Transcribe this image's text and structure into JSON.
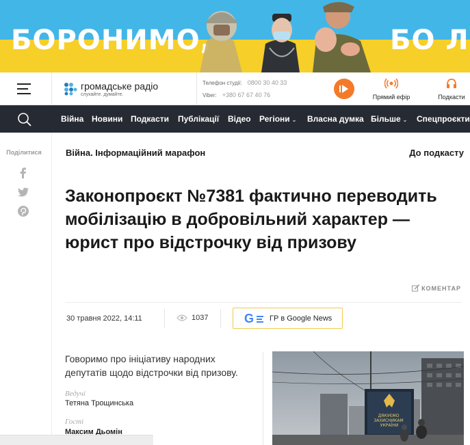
{
  "banner": {
    "text_left": "БОРОНИМО,",
    "text_right": "БО ЛК"
  },
  "header": {
    "logo_name": "громадське радіо",
    "logo_slogan": "слухайте. думайте.",
    "contacts": [
      {
        "label": "Телефон студії:",
        "value": "0800 30 40 33"
      },
      {
        "label": "Viber:",
        "value": "+380 67 67 40 76"
      }
    ],
    "live_label": "Прямий ефір",
    "podcasts_label": "Подкасти"
  },
  "nav": {
    "items": [
      {
        "label": "Війна",
        "dropdown": false
      },
      {
        "label": "Новини",
        "dropdown": false
      },
      {
        "label": "Подкасти",
        "dropdown": false
      },
      {
        "label": "Публікації",
        "dropdown": false
      },
      {
        "label": "Відео",
        "dropdown": false
      },
      {
        "label": "Регіони",
        "dropdown": true
      },
      {
        "label": "Власна думка",
        "dropdown": false
      },
      {
        "label": "Більше",
        "dropdown": true
      },
      {
        "label": "Спецпроєкти",
        "dropdown": false
      }
    ]
  },
  "share": {
    "label": "Поділитися",
    "icons": [
      "facebook-icon",
      "twitter-icon",
      "pinterest-icon"
    ]
  },
  "article": {
    "category": "Війна. Інформаційний марафон",
    "to_podcast": "До подкасту",
    "title": "Законопроєкт №7381 фактично переводить мобілізацію в добровільний характер — юрист про відстрочку від призову",
    "comment_label": "КОМЕНТАР",
    "date": "30 травня 2022, 14:11",
    "views": "1037",
    "google_news_label": "ГР в Google News",
    "lead": "Говоримо про ініціативу народних депутатів щодо відстрочки від призову.",
    "hosts_label": "Ведучі",
    "host": "Тетяна Трощинська",
    "guests_label": "Гості",
    "guest": "Максим Дьомін",
    "photo_billboard_text": "ДЯКУЄМО ЗАХИСНИКАМ УКРАЇНИ"
  },
  "colors": {
    "banner_blue": "#43b6e8",
    "banner_yellow": "#f6cf28",
    "nav_bg": "#262b33",
    "accent_orange": "#f47a2a",
    "google_blue": "#4285f4"
  }
}
